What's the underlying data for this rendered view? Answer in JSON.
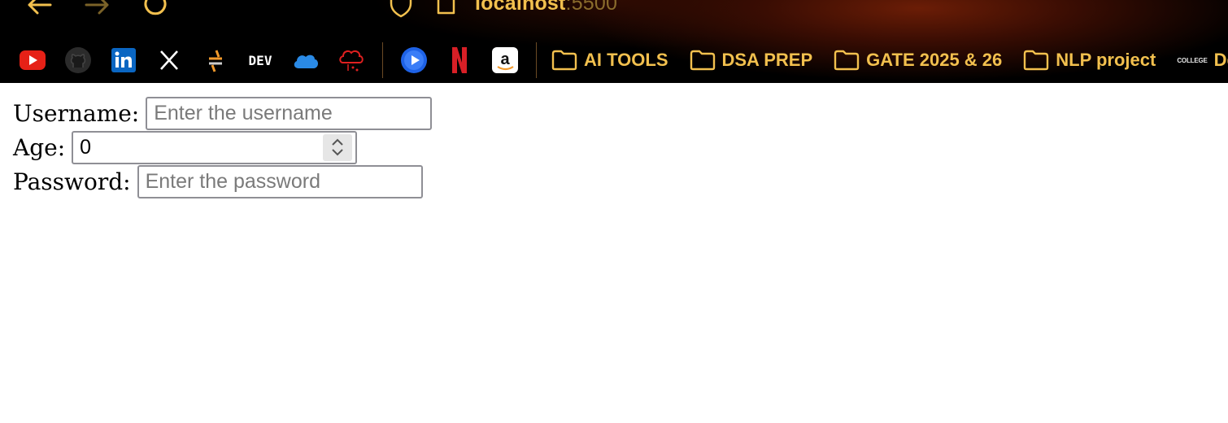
{
  "browser": {
    "url_host": "localhost",
    "url_port": ":5500",
    "accent": "#f2c04e",
    "bookmark_icons": [
      "youtube-icon",
      "github-icon",
      "linkedin-icon",
      "x-icon",
      "sourcegraph-icon",
      "dev-icon",
      "onedrive-icon",
      "cloud-icon",
      "play-icon",
      "netflix-icon",
      "amazon-icon"
    ],
    "dev_label": "DEV",
    "folders": [
      "AI TOOLS",
      "DSA PREP",
      "GATE 2025 & 26",
      "NLP project"
    ],
    "college_logo_text": "COLLEGE",
    "truncated_bookmark": "Del"
  },
  "form": {
    "username_label": "Username:",
    "username_placeholder": "Enter the username",
    "age_label": "Age:",
    "age_value": "0",
    "password_label": "Password:",
    "password_placeholder": "Enter the password"
  }
}
